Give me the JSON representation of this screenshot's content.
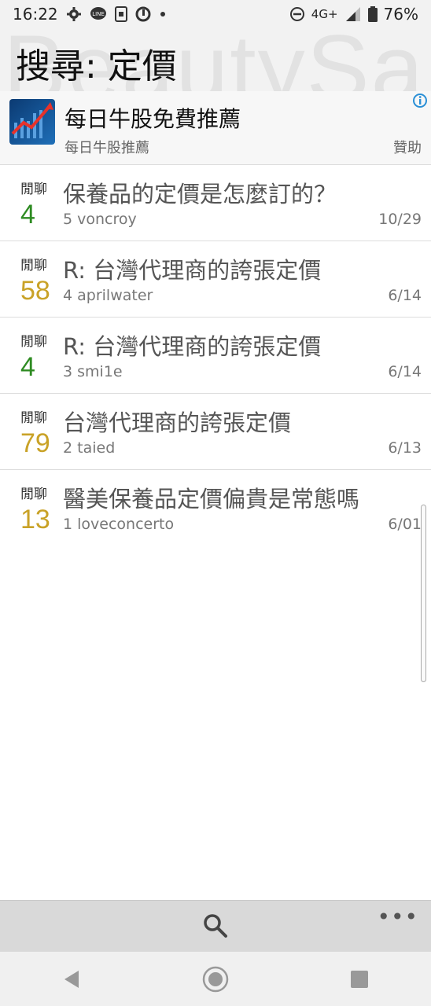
{
  "status_bar": {
    "time": "16:22",
    "network": "4G+",
    "battery": "76%",
    "icons": [
      "settings-icon",
      "line-icon",
      "sim-icon",
      "shield-icon",
      "dot-icon",
      "dnd-icon",
      "signal-icon",
      "battery-icon"
    ]
  },
  "header": {
    "watermark": "BeautySa",
    "title": "搜尋: 定價"
  },
  "ad": {
    "title": "每日牛股免費推薦",
    "subtitle": "每日牛股推薦",
    "sponsor_label": "贊助"
  },
  "results": [
    {
      "category": "閒聊",
      "count": "4",
      "count_color": "#2e8b22",
      "title": "保養品的定價是怎麼訂的？",
      "meta": "5 voncroy",
      "date": "10/29"
    },
    {
      "category": "閒聊",
      "count": "58",
      "count_color": "#c9a227",
      "title": "R: 台灣代理商的誇張定價",
      "meta": "4 aprilwater",
      "date": "6/14"
    },
    {
      "category": "閒聊",
      "count": "4",
      "count_color": "#2e8b22",
      "title": "R: 台灣代理商的誇張定價",
      "meta": "3 smi1e",
      "date": "6/14"
    },
    {
      "category": "閒聊",
      "count": "79",
      "count_color": "#c9a227",
      "title": "台灣代理商的誇張定價",
      "meta": "2 taied",
      "date": "6/13"
    },
    {
      "category": "閒聊",
      "count": "13",
      "count_color": "#c9a227",
      "title": "醫美保養品定價偏貴是常態嗎",
      "meta": "1 loveconcerto",
      "date": "6/01"
    }
  ],
  "bottom_bar": {
    "more_label": "•••"
  },
  "colors": {
    "green": "#2e8b22",
    "gold": "#c9a227",
    "header_bg": "#f2f2f2"
  }
}
